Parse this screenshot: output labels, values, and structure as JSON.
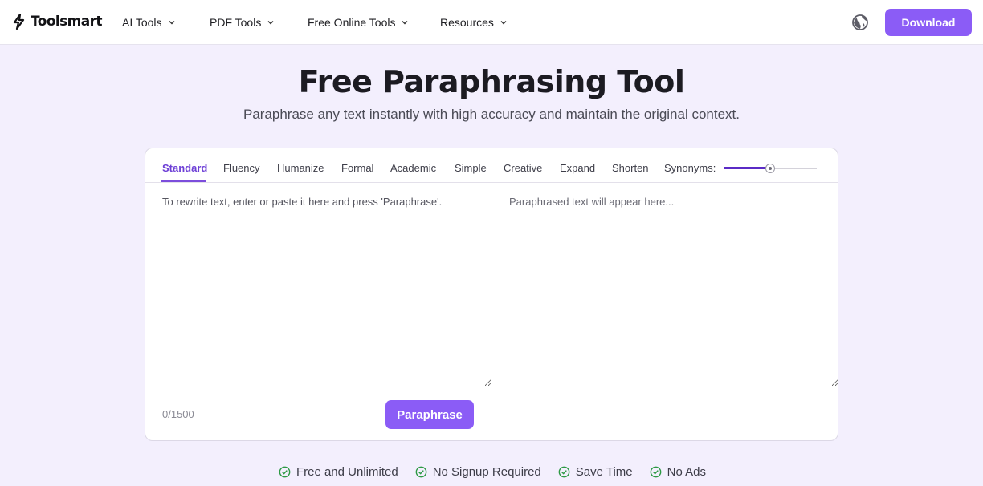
{
  "header": {
    "logo_text": "Toolsmart",
    "nav": [
      {
        "label": "AI Tools",
        "icon": "chevron-down-icon"
      },
      {
        "label": "PDF Tools",
        "icon": "chevron-down-icon"
      },
      {
        "label": "Free Online Tools",
        "icon": "chevron-down-icon"
      },
      {
        "label": "Resources",
        "icon": "chevron-down-icon"
      }
    ],
    "language_icon": "globe-icon",
    "download_label": "Download"
  },
  "hero": {
    "title": "Free Paraphrasing Tool",
    "subtitle": "Paraphrase any text instantly with high accuracy and maintain the original context."
  },
  "tool": {
    "modes": [
      "Standard",
      "Fluency",
      "Humanize",
      "Formal",
      "Academic",
      "Simple",
      "Creative",
      "Expand",
      "Shorten"
    ],
    "active_mode": "Standard",
    "synonyms_label": "Synonyms:",
    "synonyms_level": 0.5,
    "input": {
      "value": "",
      "placeholder": "To rewrite text, enter or paste it here and press 'Paraphrase'."
    },
    "output": {
      "value": "",
      "placeholder": "Paraphrased text will appear here..."
    },
    "char_count": "0/1500",
    "paraphrase_label": "Paraphrase"
  },
  "features": [
    {
      "label": "Free and Unlimited",
      "icon": "check-circle-icon"
    },
    {
      "label": "No Signup Required",
      "icon": "check-circle-icon"
    },
    {
      "label": "Save Time",
      "icon": "check-circle-icon"
    },
    {
      "label": "No Ads",
      "icon": "check-circle-icon"
    }
  ],
  "colors": {
    "accent": "#8b5cf6",
    "active_tab": "#6d3fd6",
    "page_background": "#f3effd",
    "check_green": "#2e9a45"
  }
}
